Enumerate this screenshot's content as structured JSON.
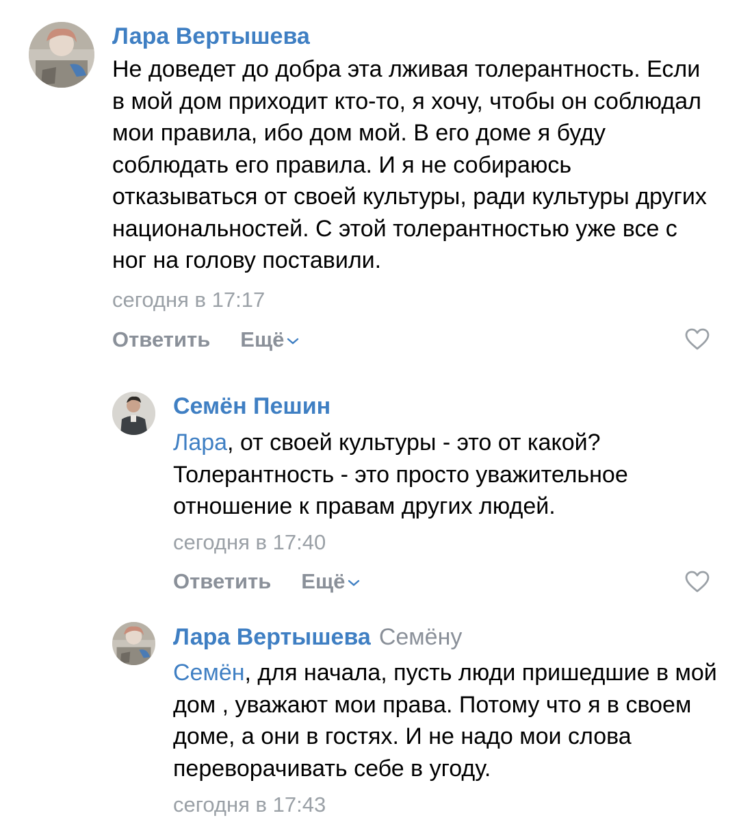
{
  "comments": [
    {
      "author": "Лара Вертышева",
      "text": "Не доведет до добра эта лживая толерантность. Если в мой дом приходит кто-то, я хочу, чтобы он соблюдал мои правила, ибо дом мой. В его доме я буду соблюдать его правила. И я не собираюсь отказываться от своей культуры, ради культуры других национальностей. С этой толерантностью уже все с ног на голову поставили.",
      "time": "сегодня в 17:17",
      "reply_label": "Ответить",
      "more_label": "Ещё"
    },
    {
      "author": "Семён Пешин",
      "mention": "Лара",
      "text": ", от своей культуры - это от какой? Толерантность - это просто уважительное отношение к правам других людей.",
      "time": "сегодня в 17:40",
      "reply_label": "Ответить",
      "more_label": "Ещё"
    },
    {
      "author": "Лара Вертышева",
      "reply_to": "Семёну",
      "mention": "Семён",
      "text": ", для начала, пусть люди пришедшие в мой дом , уважают мои права. Потому что я в своем доме, а они в гостях. И не надо мои слова переворачивать себе в угоду.",
      "time": "сегодня в 17:43"
    }
  ],
  "colors": {
    "link": "#3f7fc3",
    "meta": "#9aa0a6",
    "action": "#8a9099"
  },
  "icons": {
    "like": "heart-outline-icon",
    "more": "chevron-down-icon"
  }
}
